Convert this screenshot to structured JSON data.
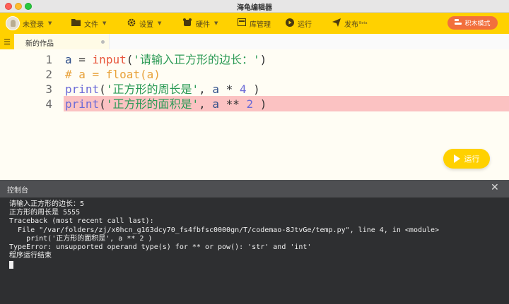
{
  "window": {
    "title": "海龟编辑器"
  },
  "toolbar": {
    "login_label": "未登录",
    "file_label": "文件",
    "settings_label": "设置",
    "hardware_label": "硬件",
    "library_label": "库管理",
    "run_label": "运行",
    "publish_label": "发布",
    "publish_badge": "Beta",
    "mode_label": "积木模式"
  },
  "tabs": [
    {
      "label": "新的作品"
    }
  ],
  "editor": {
    "lines": [
      {
        "num": "1",
        "parts": [
          [
            "a",
            "var"
          ],
          [
            " = ",
            "op"
          ],
          [
            "input",
            "fn"
          ],
          [
            "(",
            "paren"
          ],
          [
            "'请输入正方形的边长：'",
            "str"
          ],
          [
            ")",
            "paren"
          ]
        ]
      },
      {
        "num": "2",
        "parts": [
          [
            "# a = float(a)",
            "cmt"
          ]
        ]
      },
      {
        "num": "3",
        "parts": [
          [
            "print",
            "print"
          ],
          [
            "(",
            "paren"
          ],
          [
            "'正方形的周长是'",
            "str"
          ],
          [
            ", ",
            "op"
          ],
          [
            "a",
            "var"
          ],
          [
            " * ",
            "op"
          ],
          [
            "4",
            "num"
          ],
          [
            " )",
            "paren"
          ]
        ]
      },
      {
        "num": "4",
        "parts": [
          [
            "print",
            "print"
          ],
          [
            "(",
            "paren"
          ],
          [
            "'正方形的面积是'",
            "str"
          ],
          [
            ", ",
            "op"
          ],
          [
            "a",
            "var"
          ],
          [
            " ** ",
            "op"
          ],
          [
            "2",
            "num"
          ],
          [
            " )",
            "paren"
          ]
        ]
      }
    ],
    "error_line": 4,
    "run_button_label": "运行"
  },
  "console": {
    "title": "控制台",
    "close_glyph": "✕",
    "lines": [
      "请输入正方形的边长：5",
      "正方形的周长是 5555",
      "Traceback (most recent call last):",
      "  File \"/var/folders/zj/x0hcn_g163dcy70_fs4fbfsc0000gn/T/codemao-8JtvGe/temp.py\", line 4, in <module>",
      "    print('正方形的面积是', a ** 2 )",
      "TypeError: unsupported operand type(s) for ** or pow(): 'str' and 'int'",
      "程序运行结束"
    ]
  },
  "icons": {
    "file": "folder-icon",
    "settings": "gear-icon",
    "hardware": "chip-icon",
    "library": "library-icon",
    "run": "play-icon",
    "publish": "send-icon",
    "mode": "blocks-icon"
  },
  "colors": {
    "toolbar_bg": "#ffd100",
    "mode_button": "#f26f3c",
    "error_line_bg": "#fbc2c2",
    "console_bg": "#2e2f31"
  }
}
